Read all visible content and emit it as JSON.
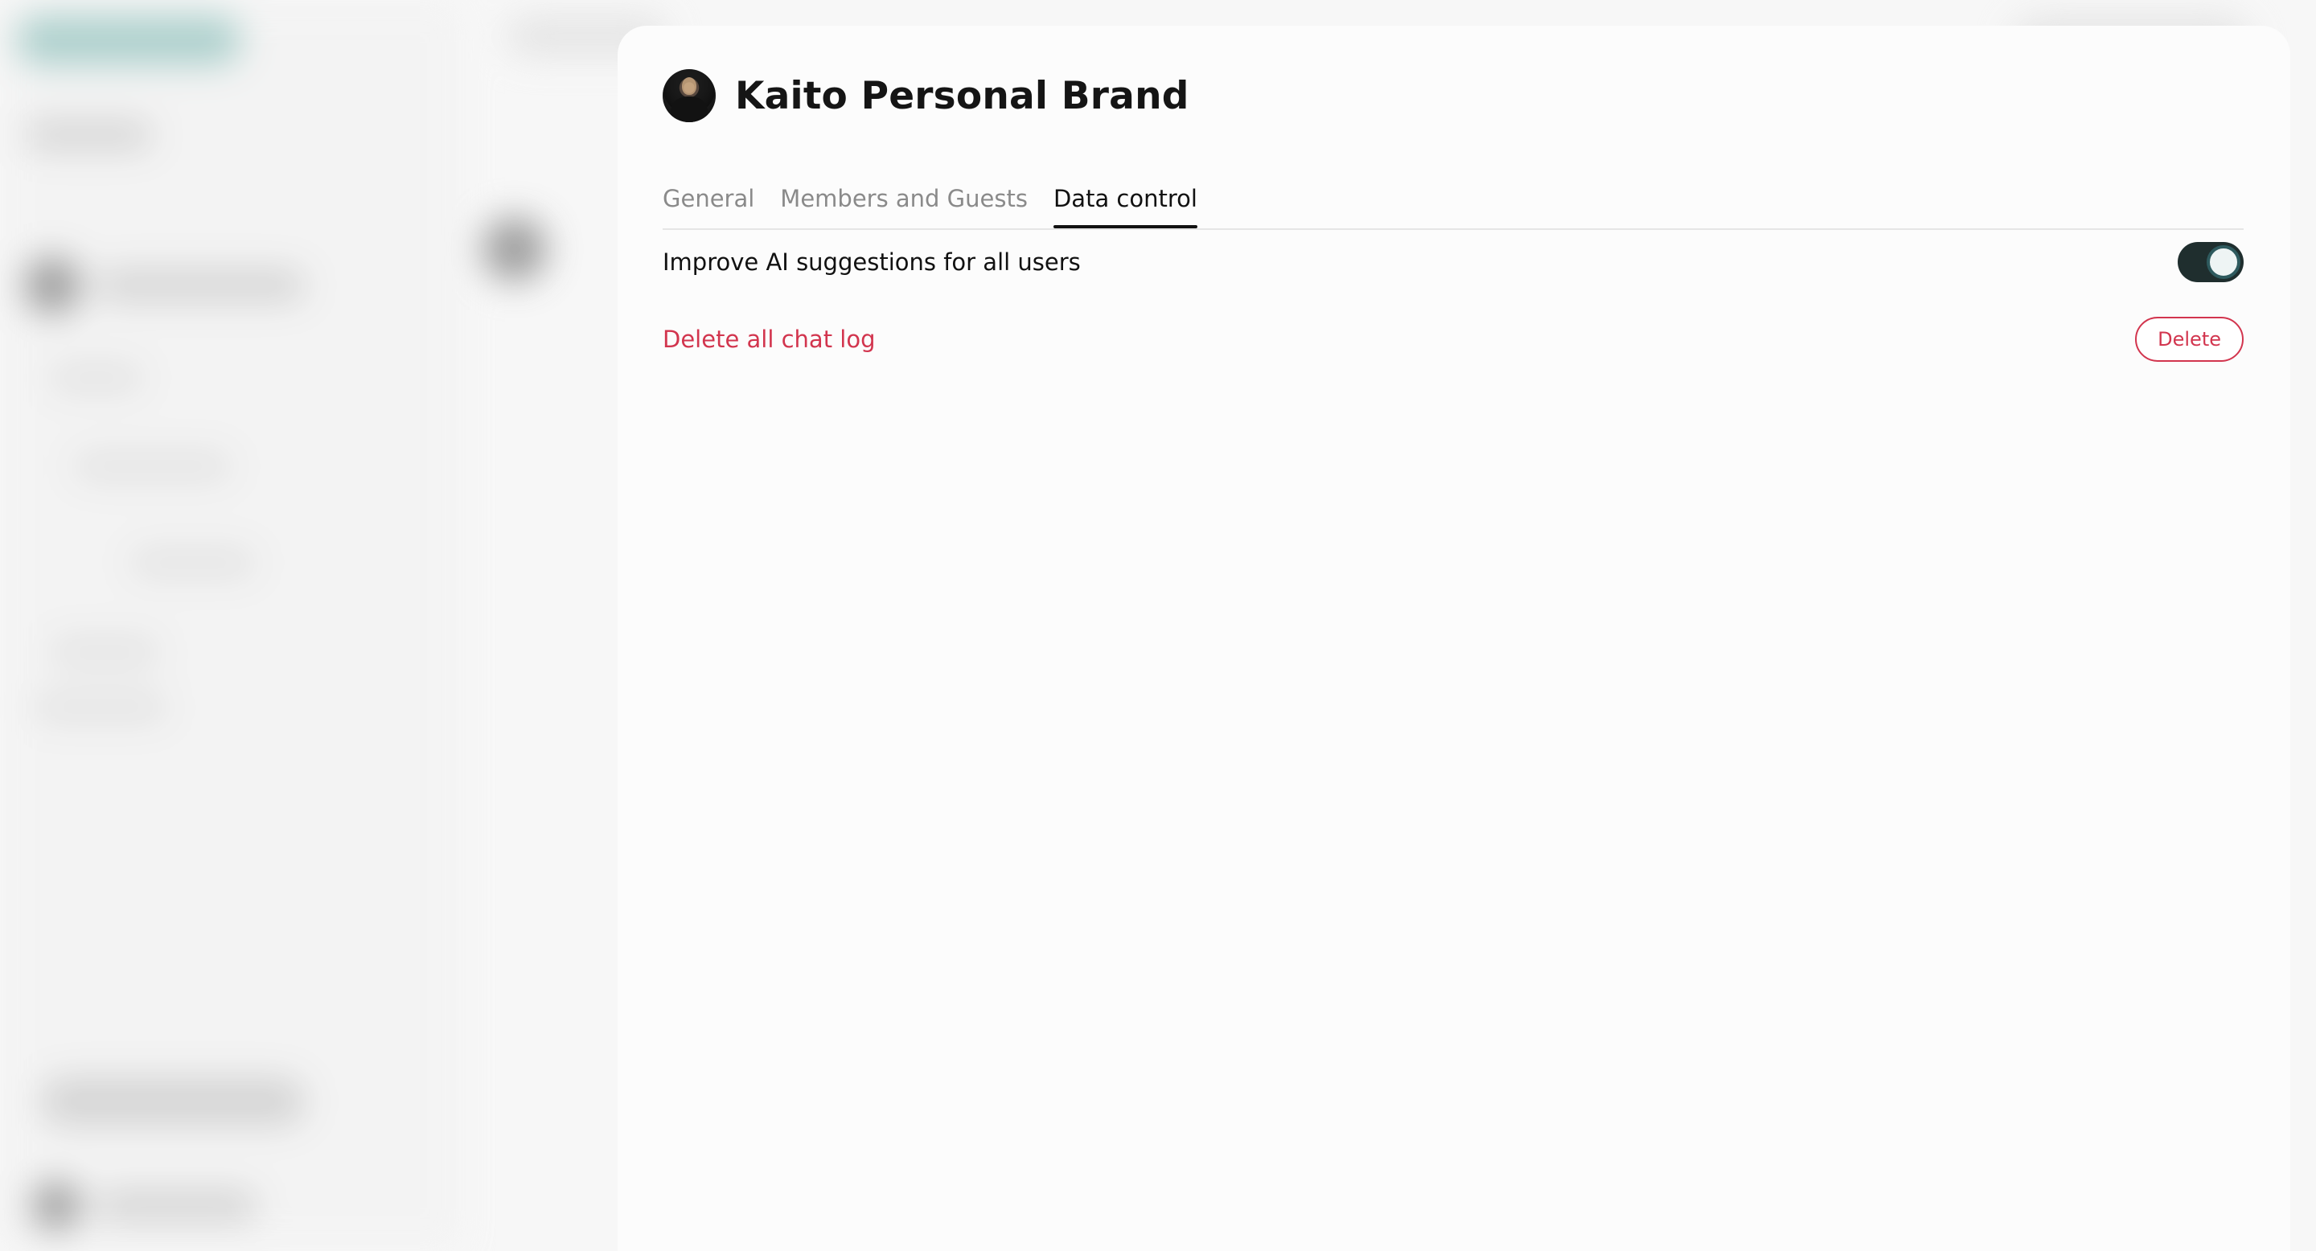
{
  "workspace": {
    "title": "Kaito Personal Brand"
  },
  "tabs": [
    {
      "label": "General",
      "active": false
    },
    {
      "label": "Members and Guests",
      "active": false
    },
    {
      "label": "Data control",
      "active": true
    }
  ],
  "settings": {
    "improve_ai": {
      "label": "Improve AI suggestions for all users",
      "enabled": true
    },
    "delete_chat": {
      "label": "Delete all chat log",
      "button_label": "Delete"
    }
  },
  "colors": {
    "danger": "#d2354e",
    "toggle_on": "#1f2e2e",
    "toggle_knob_ring": "#2e5a5e"
  }
}
